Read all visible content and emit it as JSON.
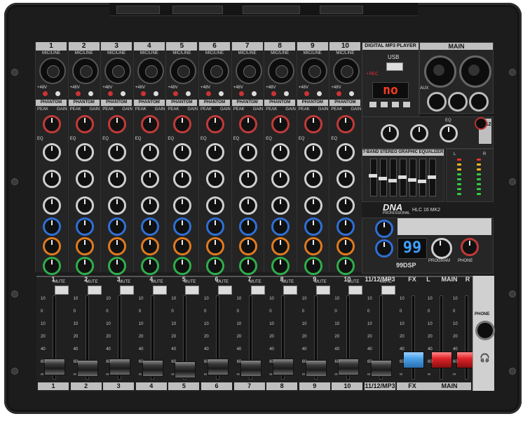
{
  "channels": [
    {
      "num": "1",
      "input": "MIC/LINE",
      "phantom": "PHANTOM",
      "fader": "1"
    },
    {
      "num": "2",
      "input": "MIC/LINE",
      "phantom": "PHANTOM",
      "fader": "2"
    },
    {
      "num": "3",
      "input": "MIC/LINE",
      "phantom": "PHANTOM",
      "fader": "3"
    },
    {
      "num": "4",
      "input": "MIC/LINE",
      "phantom": "PHANTOM",
      "fader": "4"
    },
    {
      "num": "5",
      "input": "MIC/LINE",
      "phantom": "PHANTOM",
      "fader": "5"
    },
    {
      "num": "6",
      "input": "MIC/LINE",
      "phantom": "PHANTOM",
      "fader": "6"
    },
    {
      "num": "7",
      "input": "MIC/LINE",
      "phantom": "PHANTOM",
      "fader": "7"
    },
    {
      "num": "8",
      "input": "MIC/LINE",
      "phantom": "PHANTOM",
      "fader": "8"
    },
    {
      "num": "9",
      "input": "MIC/LINE",
      "phantom": "PHANTOM",
      "fader": "9"
    },
    {
      "num": "10",
      "input": "MIC/LINE",
      "phantom": "PHANTOM",
      "fader": "10"
    }
  ],
  "labels": {
    "peak": "PEAK",
    "gain": "GAIN",
    "eq": "EQ",
    "plus48": "+48V",
    "rec": "• REC",
    "mute": "MUTE",
    "fx": "FX",
    "main": "MAIN",
    "l": "L",
    "r": "R",
    "phone": "PHONE",
    "aux": "AUX",
    "program": "PROGRAM",
    "ch1112": "11/12",
    "ch1112mp3": "11/12/MP3"
  },
  "mp3": {
    "title": "DIGITAL MP3 PLAYER",
    "usb": "USB",
    "display": "no"
  },
  "main_panel": {
    "title": "MAIN"
  },
  "geq": {
    "title": "7-BAND STEREO GRAPHIC EQUALIZER",
    "levels": [
      0.55,
      0.45,
      0.4,
      0.5,
      0.42,
      0.38,
      0.5
    ]
  },
  "brand": {
    "logo": "DNA",
    "sub": "PROFESSIONAL",
    "model": "HLC 16 MK2"
  },
  "fx": {
    "title": "99 DSP DIGITAL EFFECTS",
    "display": "99",
    "logo": "99DSP"
  },
  "fader_scale": [
    "10",
    "0",
    "10",
    "20",
    "40",
    "60",
    "∞"
  ],
  "colors": {
    "red_cap": "#e0242a",
    "blue_cap": "#4aa3e8",
    "panel": "#1c1c1c",
    "label": "#bfbfbf"
  }
}
